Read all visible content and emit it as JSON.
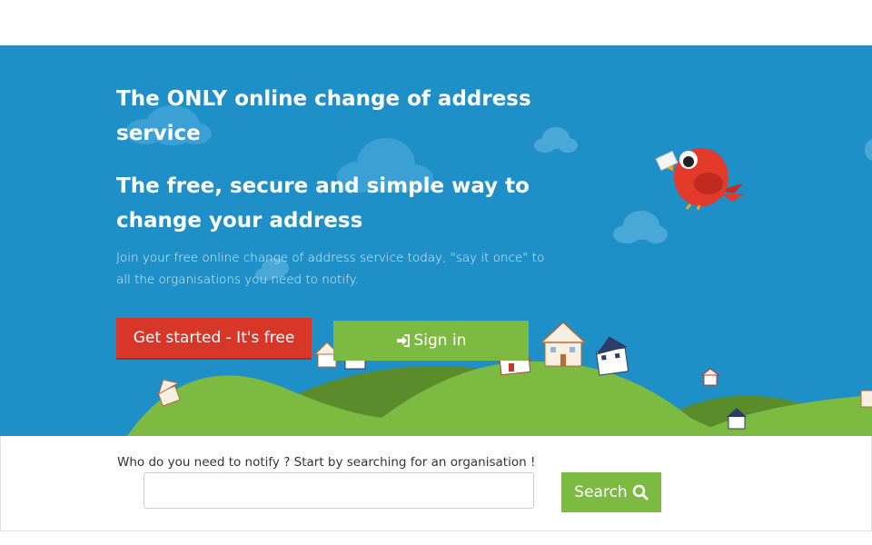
{
  "hero": {
    "headline_1": "The ONLY online change of address service",
    "headline_2": "The free, secure and simple way to change your address",
    "subtext": "Join your free online change of address service today, \"say it once\" to all the organisations you need to notify.",
    "get_started_label": "Get started - It's free",
    "sign_in_label": "Sign in"
  },
  "search": {
    "prompt": "Who do you need to notify ? Start by searching for an organisation !",
    "input_value": "",
    "button_label": "Search"
  },
  "icons": {
    "sign_in": "sign-in-icon",
    "search": "search-icon",
    "mascot": "bird-mascot"
  },
  "colors": {
    "sky": "#1e8fc7",
    "primary_red": "#d9362a",
    "primary_green": "#7cba42",
    "hill_light": "#7cba42",
    "hill_dark": "#5b8c2c"
  }
}
